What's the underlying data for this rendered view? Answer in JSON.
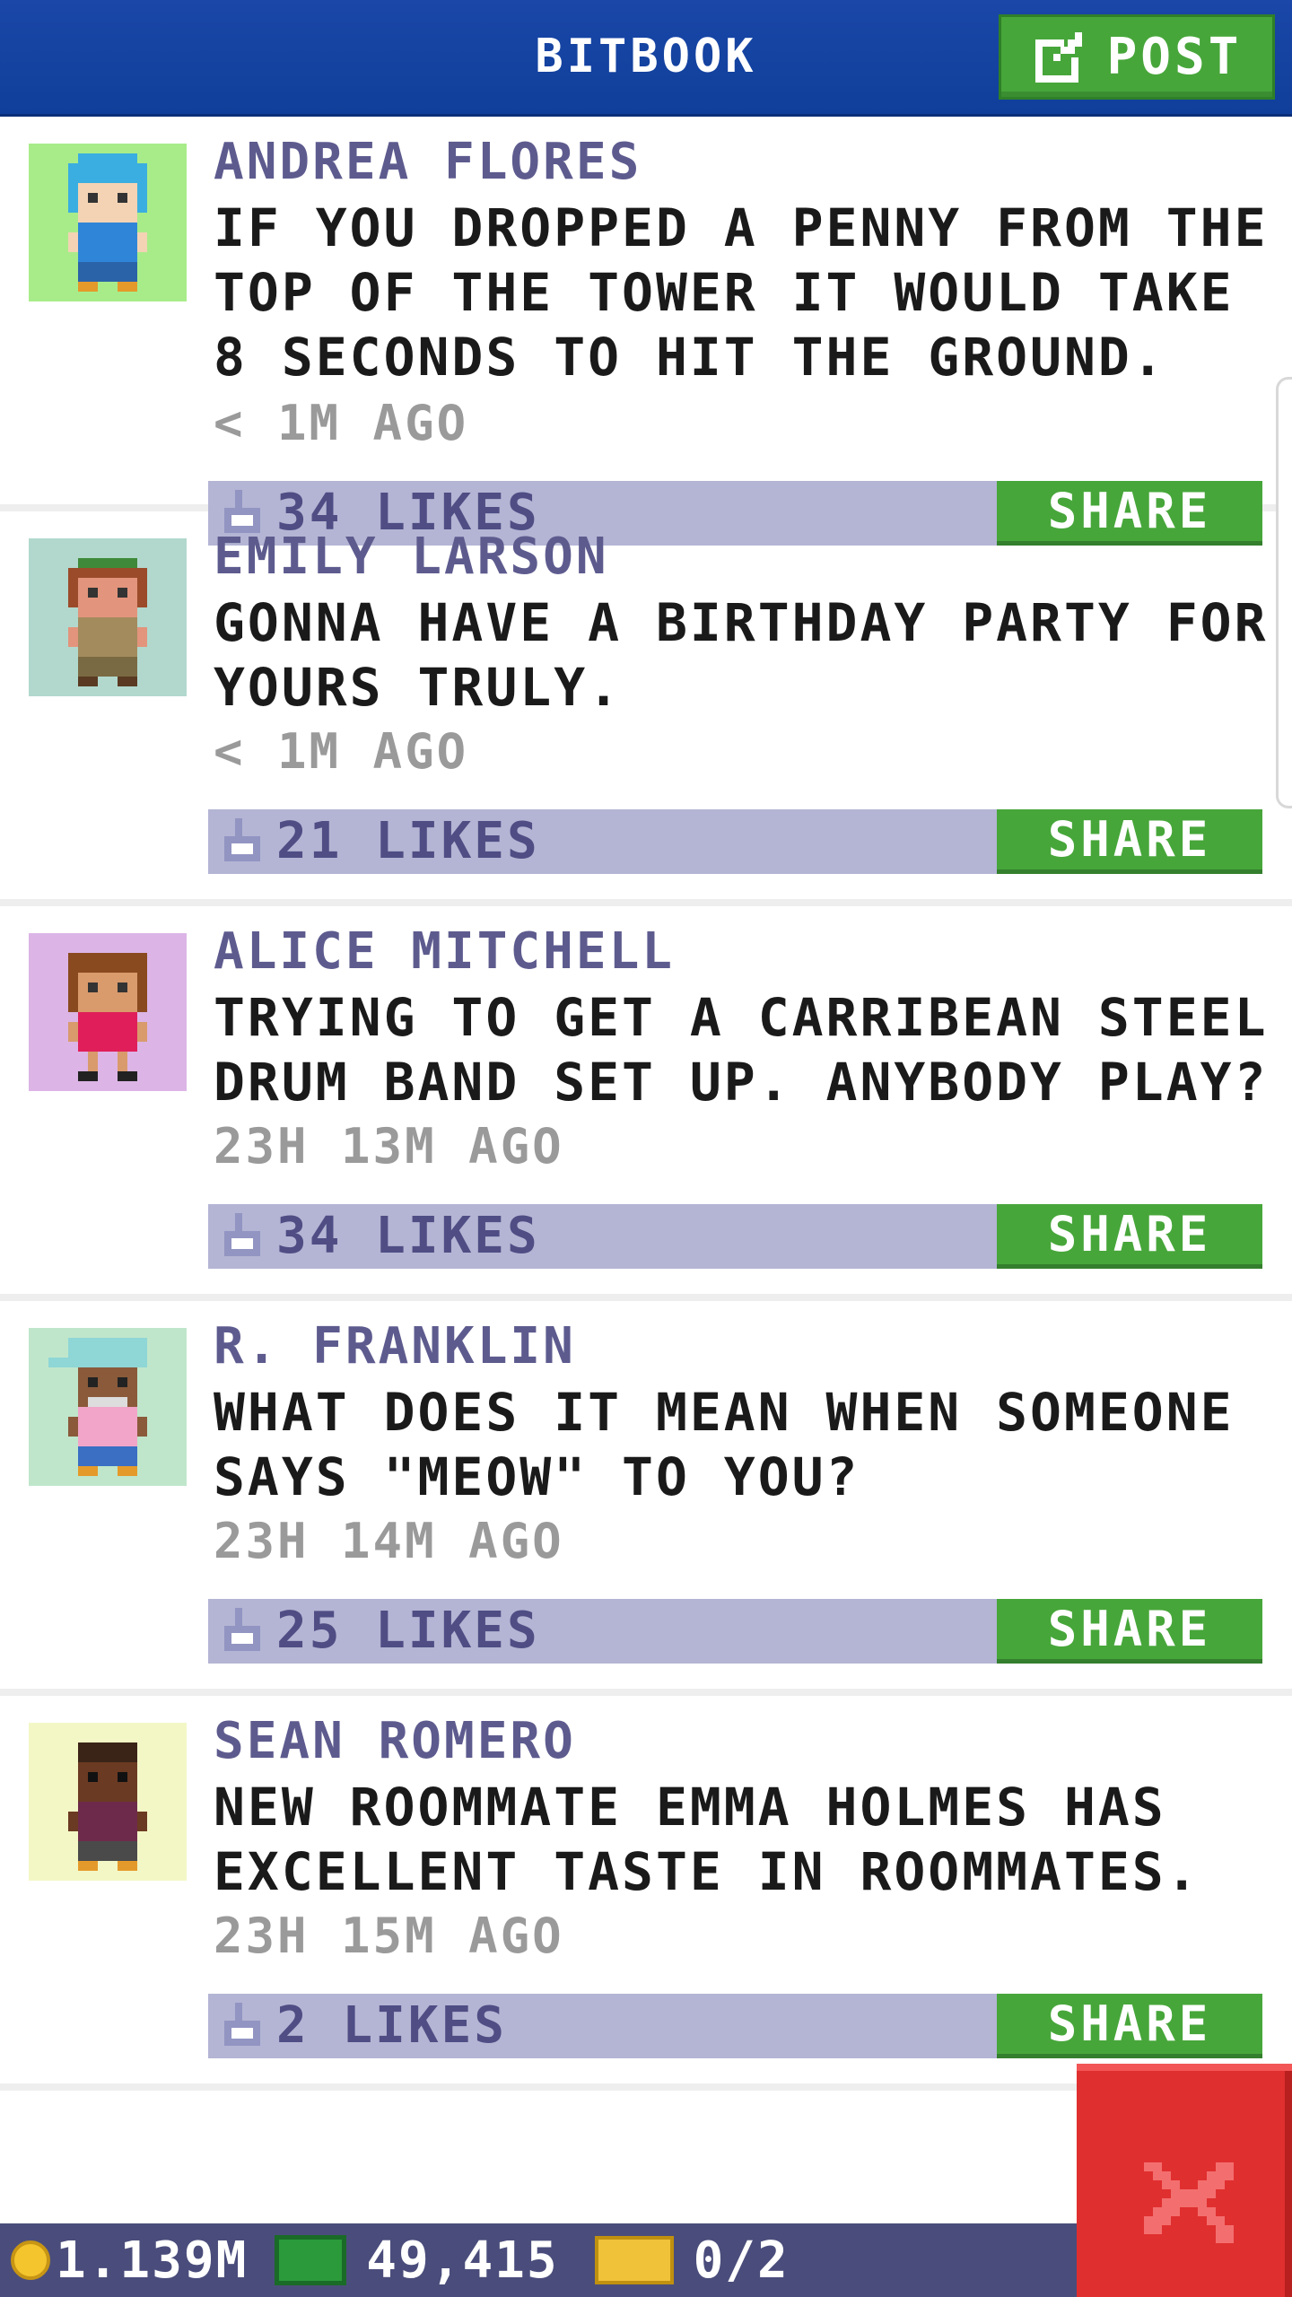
{
  "header": {
    "title": "BITBOOK",
    "post_label": "POST"
  },
  "colors": {
    "header_blue": "#1a47a8",
    "accent_green": "#47a63a",
    "likes_bar": "#b4b5d4",
    "author": "#5d5b8e",
    "close_red": "#e02f2f"
  },
  "posts": [
    {
      "author": "ANDREA FLORES",
      "text": "IF YOU DROPPED A PENNY FROM THE TOP OF THE TOWER IT WOULD TAKE 8 SECONDS TO HIT THE GROUND.",
      "time": "< 1M AGO",
      "likes": "34 LIKES",
      "share": "SHARE",
      "avatar_bg": "#a8ec8a"
    },
    {
      "author": "EMILY LARSON",
      "text": "GONNA HAVE A BIRTHDAY PARTY FOR YOURS TRULY.",
      "time": "< 1M AGO",
      "likes": "21 LIKES",
      "share": "SHARE",
      "avatar_bg": "#b2d8cd"
    },
    {
      "author": "ALICE MITCHELL",
      "text": "TRYING TO GET A CARRIBEAN STEEL DRUM BAND SET UP. ANYBODY PLAY?",
      "time": "23H 13M AGO",
      "likes": "34 LIKES",
      "share": "SHARE",
      "avatar_bg": "#dcb5e6"
    },
    {
      "author": "R. FRANKLIN",
      "text": "WHAT DOES IT MEAN WHEN SOMEONE SAYS \"MEOW\" TO YOU?",
      "time": "23H 14M AGO",
      "likes": "25 LIKES",
      "share": "SHARE",
      "avatar_bg": "#bfe6cb"
    },
    {
      "author": "SEAN ROMERO",
      "text": "NEW ROOMMATE EMMA HOLMES HAS EXCELLENT TASTE IN ROOMMATES.",
      "time": "23H 15M AGO",
      "likes": "2 LIKES",
      "share": "SHARE",
      "avatar_bg": "#f3f7c6"
    }
  ],
  "footer": {
    "coins": "1.139M",
    "bux": "49,415",
    "tickets": "0/2"
  }
}
